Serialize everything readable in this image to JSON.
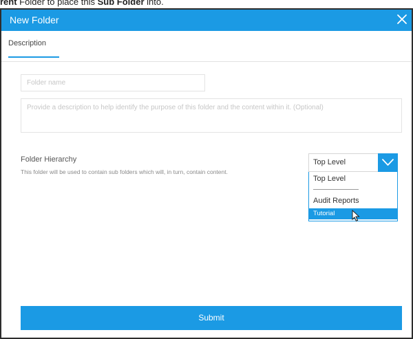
{
  "note": {
    "prefix": "rent",
    "middle": " Folder to place this ",
    "bold": "Sub Folder",
    "suffix": " into."
  },
  "dialog": {
    "title": "New Folder",
    "tabs": [
      {
        "label": "Description"
      }
    ],
    "folder_name": {
      "placeholder": "Folder name"
    },
    "description": {
      "placeholder": "Provide a description to help identify the purpose of this folder and the content within it. (Optional)"
    },
    "hierarchy": {
      "title": "Folder Hierarchy",
      "description": "This folder will be used to contain sub folders which will, in turn, contain content.",
      "selected": "Top Level",
      "options": [
        "Top Level",
        "Audit Reports",
        "Tutorial"
      ],
      "highlighted": "Tutorial"
    },
    "submit_label": "Submit"
  },
  "colors": {
    "accent": "#1b9ae4"
  },
  "icons": {
    "close": "close-icon",
    "dropdown": "chevron-down-icon",
    "pointer": "mouse-pointer-icon"
  }
}
